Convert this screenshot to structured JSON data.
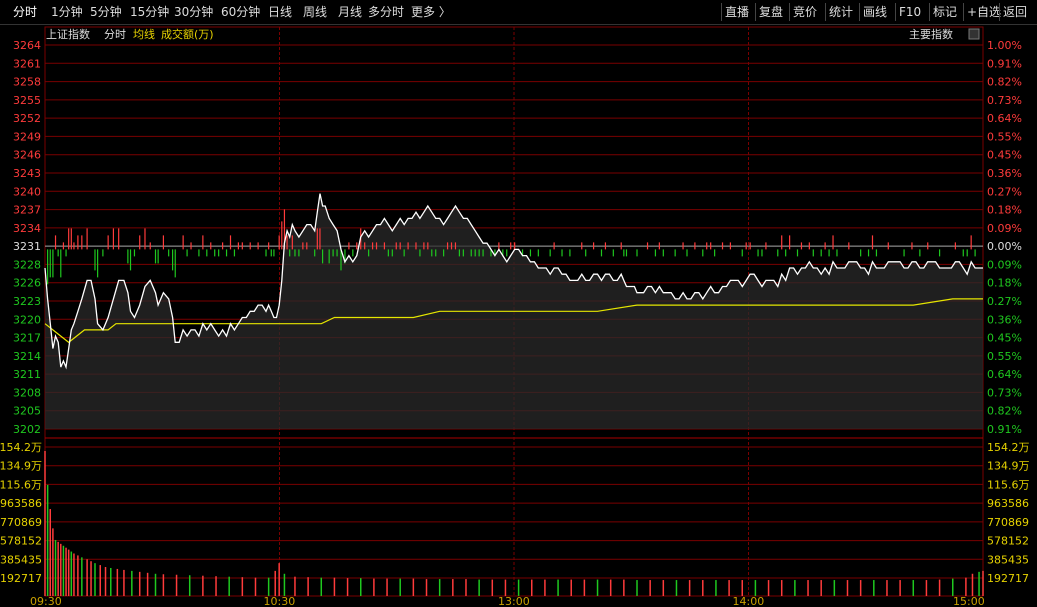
{
  "toolbar": {
    "left_items": [
      "分时",
      "1分钟",
      "5分钟",
      "15分钟",
      "30分钟",
      "60分钟",
      "日线",
      "周线",
      "月线",
      "多分时",
      "更多 〉"
    ],
    "active_index": 0,
    "right_items": [
      "直播",
      "复盘",
      "竞价",
      "统计",
      "画线",
      "F10",
      "标记",
      "+自选",
      "返回"
    ]
  },
  "header": {
    "index_name": "上证指数",
    "mode_label": "分时",
    "avg_label": "均线",
    "volume_label": "成交额(万)",
    "main_index_label": "主要指数"
  },
  "colors": {
    "up": "#ff3b3b",
    "down": "#1fc81f",
    "price_line": "#ffffff",
    "avg_line": "#e6e600",
    "grid": "#7a0000",
    "tick_yellow": "#e6d200"
  },
  "chart_data": {
    "type": "line",
    "prev_close": 3231,
    "price_ticks": [
      "3264",
      "3261",
      "3258",
      "3255",
      "3252",
      "3249",
      "3246",
      "3243",
      "3240",
      "3237",
      "3234",
      "3231",
      "3228",
      "3226",
      "3223",
      "3220",
      "3217",
      "3214",
      "3211",
      "3208",
      "3205",
      "3202"
    ],
    "pct_ticks": [
      "1.00%",
      "0.91%",
      "0.82%",
      "0.73%",
      "0.64%",
      "0.55%",
      "0.45%",
      "0.36%",
      "0.27%",
      "0.18%",
      "0.09%",
      "0.00%",
      "0.09%",
      "0.18%",
      "0.27%",
      "0.36%",
      "0.45%",
      "0.55%",
      "0.64%",
      "0.73%",
      "0.82%",
      "0.91%"
    ],
    "ylim": [
      3202,
      3264
    ],
    "volume_ticks": [
      "154.2万",
      "134.9万",
      "115.6万",
      "963586",
      "770869",
      "578152",
      "385435",
      "192717"
    ],
    "volume_ylim": [
      0,
      1542000
    ],
    "x_ticks": [
      "09:30",
      "10:30",
      "13:00",
      "14:00",
      "15:00"
    ],
    "price_points": [
      [
        0,
        3228
      ],
      [
        2,
        3223
      ],
      [
        4,
        3219
      ],
      [
        6,
        3215
      ],
      [
        8,
        3217
      ],
      [
        10,
        3216
      ],
      [
        12,
        3212
      ],
      [
        14,
        3213
      ],
      [
        16,
        3212
      ],
      [
        18,
        3215
      ],
      [
        20,
        3218
      ],
      [
        22,
        3219
      ],
      [
        25,
        3221
      ],
      [
        28,
        3223
      ],
      [
        32,
        3226
      ],
      [
        35,
        3226
      ],
      [
        38,
        3223
      ],
      [
        40,
        3219
      ],
      [
        44,
        3218
      ],
      [
        48,
        3220
      ],
      [
        52,
        3223
      ],
      [
        56,
        3226
      ],
      [
        60,
        3226
      ],
      [
        63,
        3224
      ],
      [
        65,
        3221
      ],
      [
        68,
        3220
      ],
      [
        72,
        3222
      ],
      [
        76,
        3225
      ],
      [
        80,
        3226
      ],
      [
        84,
        3224
      ],
      [
        86,
        3222
      ],
      [
        90,
        3224
      ],
      [
        94,
        3223
      ],
      [
        97,
        3220
      ],
      [
        99,
        3216
      ],
      [
        102,
        3216
      ],
      [
        105,
        3218
      ],
      [
        108,
        3217
      ],
      [
        111,
        3218
      ],
      [
        114,
        3218
      ],
      [
        117,
        3217
      ],
      [
        120,
        3219
      ],
      [
        123,
        3218
      ],
      [
        126,
        3219
      ],
      [
        129,
        3218
      ],
      [
        132,
        3217
      ],
      [
        135,
        3218
      ],
      [
        138,
        3217
      ],
      [
        141,
        3219
      ],
      [
        144,
        3218
      ],
      [
        147,
        3219
      ],
      [
        150,
        3220
      ],
      [
        153,
        3220
      ],
      [
        156,
        3221
      ],
      [
        159,
        3221
      ],
      [
        162,
        3222
      ],
      [
        165,
        3222
      ],
      [
        168,
        3221
      ],
      [
        170,
        3222
      ],
      [
        172,
        3221
      ],
      [
        174,
        3220
      ],
      [
        176,
        3220
      ],
      [
        178,
        3222
      ],
      [
        180,
        3226
      ],
      [
        182,
        3232
      ],
      [
        184,
        3234
      ],
      [
        186,
        3233
      ],
      [
        188,
        3235
      ],
      [
        190,
        3234
      ],
      [
        193,
        3233
      ],
      [
        196,
        3234
      ],
      [
        199,
        3235
      ],
      [
        202,
        3235
      ],
      [
        205,
        3234
      ],
      [
        207,
        3237
      ],
      [
        209,
        3240
      ],
      [
        211,
        3238
      ],
      [
        213,
        3238
      ],
      [
        216,
        3236
      ],
      [
        219,
        3235
      ],
      [
        222,
        3234
      ],
      [
        225,
        3231
      ],
      [
        228,
        3229
      ],
      [
        231,
        3230
      ],
      [
        234,
        3229
      ],
      [
        237,
        3230
      ],
      [
        240,
        3233
      ],
      [
        243,
        3234
      ],
      [
        246,
        3233
      ],
      [
        249,
        3234
      ],
      [
        252,
        3235
      ],
      [
        255,
        3235
      ],
      [
        258,
        3236
      ],
      [
        261,
        3235
      ],
      [
        264,
        3234
      ],
      [
        267,
        3235
      ],
      [
        270,
        3236
      ],
      [
        273,
        3235
      ],
      [
        276,
        3236
      ],
      [
        279,
        3236
      ],
      [
        282,
        3237
      ],
      [
        285,
        3236
      ],
      [
        288,
        3237
      ],
      [
        291,
        3238
      ],
      [
        294,
        3237
      ],
      [
        297,
        3236
      ],
      [
        300,
        3236
      ],
      [
        303,
        3235
      ],
      [
        306,
        3236
      ],
      [
        309,
        3237
      ],
      [
        312,
        3238
      ],
      [
        315,
        3237
      ],
      [
        318,
        3236
      ],
      [
        321,
        3236
      ],
      [
        324,
        3235
      ],
      [
        327,
        3234
      ],
      [
        330,
        3233
      ],
      [
        333,
        3232
      ],
      [
        336,
        3232
      ],
      [
        339,
        3231
      ],
      [
        342,
        3230
      ],
      [
        345,
        3231
      ],
      [
        348,
        3230
      ],
      [
        351,
        3229
      ],
      [
        354,
        3230
      ],
      [
        357,
        3231
      ],
      [
        360,
        3231
      ],
      [
        363,
        3230
      ],
      [
        366,
        3230
      ],
      [
        369,
        3229
      ],
      [
        372,
        3229
      ],
      [
        375,
        3228
      ],
      [
        378,
        3228
      ],
      [
        381,
        3228
      ],
      [
        384,
        3227
      ],
      [
        387,
        3228
      ],
      [
        390,
        3228
      ],
      [
        393,
        3227
      ],
      [
        396,
        3227
      ],
      [
        399,
        3226
      ],
      [
        402,
        3226
      ],
      [
        405,
        3226
      ],
      [
        408,
        3227
      ],
      [
        411,
        3226
      ],
      [
        414,
        3226
      ],
      [
        417,
        3227
      ],
      [
        420,
        3227
      ],
      [
        423,
        3226
      ],
      [
        426,
        3227
      ],
      [
        429,
        3227
      ],
      [
        432,
        3226
      ],
      [
        435,
        3226
      ],
      [
        438,
        3227
      ],
      [
        440,
        3226
      ],
      [
        442,
        3225
      ],
      [
        444,
        3225
      ],
      [
        446,
        3225
      ],
      [
        448,
        3225
      ],
      [
        450,
        3224
      ],
      [
        452,
        3224
      ],
      [
        455,
        3224
      ],
      [
        458,
        3225
      ],
      [
        461,
        3225
      ],
      [
        464,
        3224
      ],
      [
        467,
        3225
      ],
      [
        470,
        3224
      ],
      [
        473,
        3224
      ],
      [
        476,
        3224
      ],
      [
        479,
        3223
      ],
      [
        482,
        3223
      ],
      [
        485,
        3224
      ],
      [
        488,
        3223
      ],
      [
        491,
        3223
      ],
      [
        494,
        3224
      ],
      [
        497,
        3224
      ],
      [
        500,
        3223
      ],
      [
        503,
        3224
      ],
      [
        506,
        3225
      ],
      [
        509,
        3224
      ],
      [
        512,
        3224
      ],
      [
        515,
        3225
      ],
      [
        518,
        3225
      ],
      [
        521,
        3226
      ],
      [
        524,
        3226
      ],
      [
        527,
        3226
      ],
      [
        530,
        3225
      ],
      [
        533,
        3226
      ],
      [
        536,
        3227
      ],
      [
        539,
        3227
      ],
      [
        542,
        3226
      ],
      [
        545,
        3225
      ],
      [
        548,
        3226
      ],
      [
        551,
        3226
      ],
      [
        554,
        3226
      ],
      [
        557,
        3225
      ],
      [
        560,
        3227
      ],
      [
        563,
        3226
      ],
      [
        566,
        3228
      ],
      [
        569,
        3228
      ],
      [
        572,
        3227
      ],
      [
        575,
        3228
      ],
      [
        578,
        3228
      ],
      [
        581,
        3229
      ],
      [
        584,
        3228
      ],
      [
        587,
        3228
      ],
      [
        590,
        3227
      ],
      [
        593,
        3228
      ],
      [
        596,
        3227
      ],
      [
        599,
        3229
      ],
      [
        602,
        3228
      ],
      [
        605,
        3228
      ],
      [
        608,
        3228
      ],
      [
        611,
        3229
      ],
      [
        614,
        3229
      ],
      [
        617,
        3229
      ],
      [
        620,
        3228
      ],
      [
        623,
        3228
      ],
      [
        626,
        3227
      ],
      [
        629,
        3229
      ],
      [
        632,
        3228
      ],
      [
        635,
        3228
      ],
      [
        638,
        3228
      ],
      [
        641,
        3229
      ],
      [
        644,
        3229
      ],
      [
        647,
        3229
      ],
      [
        650,
        3229
      ],
      [
        653,
        3228
      ],
      [
        656,
        3228
      ],
      [
        659,
        3229
      ],
      [
        662,
        3229
      ],
      [
        665,
        3228
      ],
      [
        668,
        3228
      ],
      [
        671,
        3229
      ],
      [
        674,
        3229
      ],
      [
        677,
        3229
      ],
      [
        680,
        3228
      ],
      [
        683,
        3228
      ],
      [
        686,
        3228
      ],
      [
        689,
        3228
      ],
      [
        692,
        3229
      ],
      [
        695,
        3229
      ],
      [
        698,
        3228
      ],
      [
        701,
        3227
      ],
      [
        704,
        3229
      ],
      [
        707,
        3228
      ],
      [
        710,
        3228
      ],
      [
        713,
        3228
      ]
    ],
    "avg_points": [
      [
        0,
        3219
      ],
      [
        6,
        3218
      ],
      [
        12,
        3217
      ],
      [
        18,
        3216
      ],
      [
        24,
        3217
      ],
      [
        30,
        3218
      ],
      [
        36,
        3218
      ],
      [
        42,
        3218
      ],
      [
        48,
        3218
      ],
      [
        54,
        3219
      ],
      [
        60,
        3219
      ],
      [
        66,
        3219
      ],
      [
        72,
        3219
      ],
      [
        78,
        3219
      ],
      [
        84,
        3219
      ],
      [
        90,
        3219
      ],
      [
        96,
        3219
      ],
      [
        102,
        3219
      ],
      [
        108,
        3219
      ],
      [
        114,
        3219
      ],
      [
        120,
        3219
      ],
      [
        126,
        3219
      ],
      [
        132,
        3219
      ],
      [
        138,
        3219
      ],
      [
        144,
        3219
      ],
      [
        150,
        3219
      ],
      [
        156,
        3219
      ],
      [
        162,
        3219
      ],
      [
        168,
        3219
      ],
      [
        174,
        3219
      ],
      [
        180,
        3219
      ],
      [
        190,
        3219
      ],
      [
        200,
        3219
      ],
      [
        210,
        3219
      ],
      [
        220,
        3220
      ],
      [
        230,
        3220
      ],
      [
        240,
        3220
      ],
      [
        250,
        3220
      ],
      [
        260,
        3220
      ],
      [
        270,
        3220
      ],
      [
        280,
        3220
      ],
      [
        300,
        3221
      ],
      [
        330,
        3221
      ],
      [
        360,
        3221
      ],
      [
        390,
        3221
      ],
      [
        420,
        3221
      ],
      [
        450,
        3222
      ],
      [
        480,
        3222
      ],
      [
        510,
        3222
      ],
      [
        540,
        3222
      ],
      [
        570,
        3222
      ],
      [
        600,
        3222
      ],
      [
        630,
        3222
      ],
      [
        660,
        3222
      ],
      [
        690,
        3223
      ],
      [
        713,
        3223
      ]
    ],
    "volume_bars": [
      [
        0,
        1500000
      ],
      [
        2,
        1150000
      ],
      [
        4,
        900000
      ],
      [
        6,
        700000
      ],
      [
        8,
        580000
      ],
      [
        10,
        560000
      ],
      [
        12,
        540000
      ],
      [
        14,
        520000
      ],
      [
        16,
        500000
      ],
      [
        18,
        480000
      ],
      [
        20,
        460000
      ],
      [
        22,
        440000
      ],
      [
        25,
        420000
      ],
      [
        28,
        400000
      ],
      [
        32,
        380000
      ],
      [
        35,
        360000
      ],
      [
        38,
        340000
      ],
      [
        42,
        320000
      ],
      [
        46,
        300000
      ],
      [
        50,
        290000
      ],
      [
        55,
        280000
      ],
      [
        60,
        270000
      ],
      [
        66,
        260000
      ],
      [
        72,
        250000
      ],
      [
        78,
        240000
      ],
      [
        84,
        230000
      ],
      [
        90,
        225000
      ],
      [
        100,
        220000
      ],
      [
        110,
        215000
      ],
      [
        120,
        210000
      ],
      [
        130,
        205000
      ],
      [
        140,
        200000
      ],
      [
        150,
        195000
      ],
      [
        160,
        190000
      ],
      [
        170,
        190000
      ],
      [
        175,
        260000
      ],
      [
        178,
        340000
      ],
      [
        182,
        230000
      ],
      [
        190,
        200000
      ],
      [
        200,
        195000
      ],
      [
        210,
        190000
      ],
      [
        220,
        190000
      ],
      [
        230,
        185000
      ],
      [
        240,
        185000
      ],
      [
        250,
        180000
      ],
      [
        260,
        180000
      ],
      [
        270,
        180000
      ],
      [
        280,
        180000
      ],
      [
        290,
        175000
      ],
      [
        300,
        175000
      ],
      [
        310,
        175000
      ],
      [
        320,
        175000
      ],
      [
        330,
        170000
      ],
      [
        340,
        170000
      ],
      [
        350,
        170000
      ],
      [
        360,
        170000
      ],
      [
        370,
        170000
      ],
      [
        380,
        170000
      ],
      [
        390,
        170000
      ],
      [
        400,
        170000
      ],
      [
        410,
        170000
      ],
      [
        420,
        170000
      ],
      [
        430,
        170000
      ],
      [
        440,
        170000
      ],
      [
        450,
        165000
      ],
      [
        460,
        165000
      ],
      [
        470,
        165000
      ],
      [
        480,
        165000
      ],
      [
        490,
        165000
      ],
      [
        500,
        165000
      ],
      [
        510,
        165000
      ],
      [
        520,
        165000
      ],
      [
        530,
        165000
      ],
      [
        540,
        165000
      ],
      [
        550,
        165000
      ],
      [
        560,
        165000
      ],
      [
        570,
        165000
      ],
      [
        580,
        165000
      ],
      [
        590,
        165000
      ],
      [
        600,
        165000
      ],
      [
        610,
        165000
      ],
      [
        620,
        165000
      ],
      [
        630,
        165000
      ],
      [
        640,
        165000
      ],
      [
        650,
        165000
      ],
      [
        660,
        165000
      ],
      [
        670,
        165000
      ],
      [
        680,
        170000
      ],
      [
        690,
        180000
      ],
      [
        700,
        190000
      ],
      [
        705,
        230000
      ],
      [
        710,
        250000
      ],
      [
        713,
        260000
      ]
    ],
    "grid": true
  }
}
